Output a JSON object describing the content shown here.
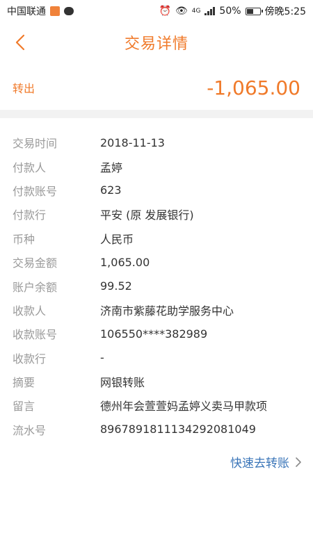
{
  "status_bar": {
    "carrier": "中国联通",
    "network": "4G",
    "battery": "50%",
    "time": "傍晚5:25"
  },
  "header": {
    "title": "交易详情"
  },
  "summary": {
    "type_label": "转出",
    "amount": "-1,065.00"
  },
  "details": [
    {
      "label": "交易时间",
      "value": "2018-11-13"
    },
    {
      "label": "付款人",
      "value": "孟婷"
    },
    {
      "label": "付款账号",
      "value": "623"
    },
    {
      "label": "付款行",
      "value": "平安  (原  发展银行)"
    },
    {
      "label": "币种",
      "value": "人民币"
    },
    {
      "label": "交易金额",
      "value": "1,065.00"
    },
    {
      "label": "账户余额",
      "value": "99.52"
    },
    {
      "label": "收款人",
      "value": "济南市紫藤花助学服务中心"
    },
    {
      "label": "收款账号",
      "value": "106550****382989"
    },
    {
      "label": "收款行",
      "value": "-"
    },
    {
      "label": "摘要",
      "value": "网银转账"
    },
    {
      "label": "留言",
      "value": "德州年会萱萱妈孟婷义卖马甲款项"
    },
    {
      "label": "流水号",
      "value": "896789181113429208104​9"
    }
  ],
  "actions": {
    "quick_transfer": "快速去转账"
  },
  "colors": {
    "accent": "#f07a2a",
    "link": "#3a75b8"
  }
}
